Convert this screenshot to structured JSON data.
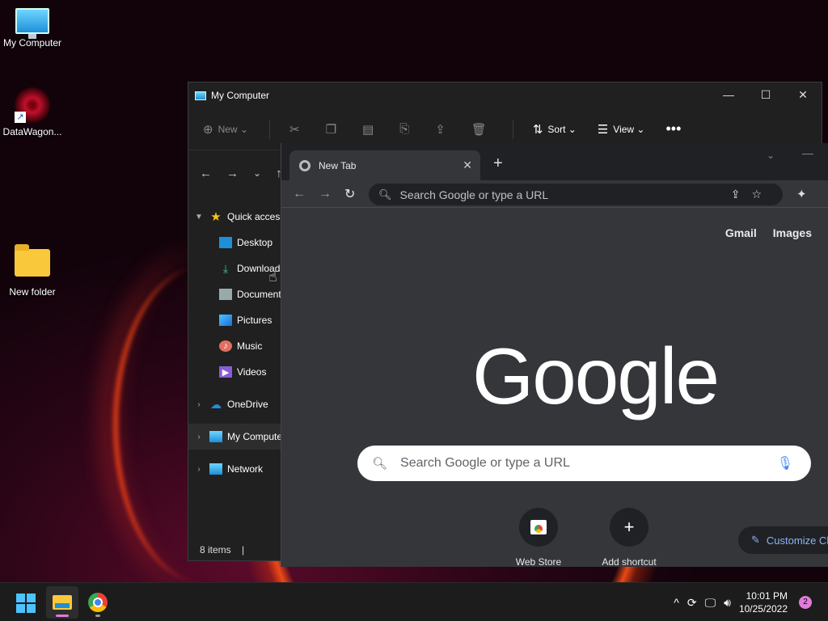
{
  "desktop": {
    "icons": [
      {
        "label": "My Computer"
      },
      {
        "label": "DataWagon..."
      },
      {
        "label": "New folder"
      }
    ]
  },
  "explorer": {
    "title": "My Computer",
    "toolbar": {
      "new_label": "New",
      "sort_label": "Sort",
      "view_label": "View"
    },
    "sidebar": {
      "quick_access": "Quick access",
      "items": [
        "Desktop",
        "Downloads",
        "Documents",
        "Pictures",
        "Music",
        "Videos"
      ],
      "onedrive": "OneDrive",
      "my_computer": "My Computer",
      "network": "Network"
    },
    "status": "8 items"
  },
  "chrome": {
    "tab_title": "New Tab",
    "omnibox_placeholder": "Search Google or type a URL",
    "links": {
      "gmail": "Gmail",
      "images": "Images"
    },
    "logo": "Google",
    "search_placeholder": "Search Google or type a URL",
    "shortcuts": [
      {
        "label": "Web Store"
      },
      {
        "label": "Add shortcut"
      }
    ],
    "customize_label": "Customize Chrome"
  },
  "taskbar": {
    "time": "10:01 PM",
    "date": "10/25/2022",
    "notification_count": "2"
  },
  "colors": {
    "accent": "#4cc2ff",
    "chrome_bg": "#35363a",
    "explorer_bg": "#202020"
  }
}
